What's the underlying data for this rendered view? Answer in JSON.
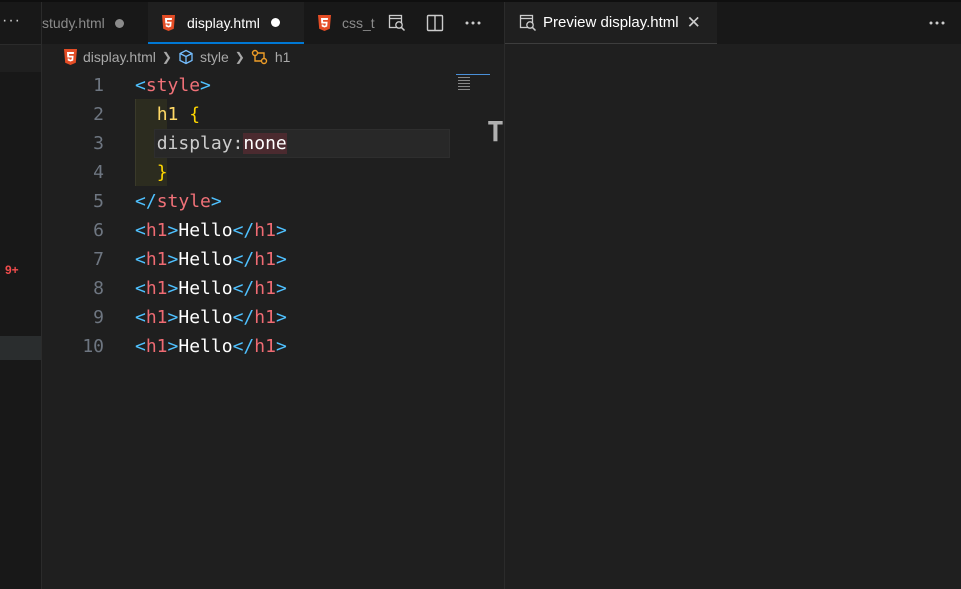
{
  "sidebar": {
    "more_label": "···",
    "problems_badge": "9+"
  },
  "tabs": [
    {
      "label": "study.html",
      "modified": true
    },
    {
      "label": "display.html",
      "modified": true,
      "active": true
    },
    {
      "label": "css_t",
      "modified": false
    }
  ],
  "breadcrumb": {
    "file": "display.html",
    "element": "style",
    "symbol": "h1"
  },
  "code": {
    "line_numbers": [
      "1",
      "2",
      "3",
      "4",
      "5",
      "6",
      "7",
      "8",
      "9",
      "10"
    ],
    "lines": [
      [
        {
          "t": "<",
          "c": "c-br"
        },
        {
          "t": "style",
          "c": "c-tag"
        },
        {
          "t": ">",
          "c": "c-br"
        }
      ],
      [
        {
          "t": "  "
        },
        {
          "t": "h1",
          "c": "c-sel"
        },
        {
          "t": " "
        },
        {
          "t": "{",
          "c": "c-brace"
        }
      ],
      [
        {
          "t": "  "
        },
        {
          "t": "display:",
          "c": "c-prop"
        },
        {
          "t": "none",
          "c": "c-text sel"
        }
      ],
      [
        {
          "t": "  "
        },
        {
          "t": "}",
          "c": "c-brace"
        }
      ],
      [
        {
          "t": "</",
          "c": "c-br"
        },
        {
          "t": "style",
          "c": "c-tag"
        },
        {
          "t": ">",
          "c": "c-br"
        }
      ],
      [
        {
          "t": "<",
          "c": "c-br"
        },
        {
          "t": "h1",
          "c": "c-tagpink"
        },
        {
          "t": ">",
          "c": "c-br"
        },
        {
          "t": "Hello",
          "c": "c-text"
        },
        {
          "t": "</",
          "c": "c-br"
        },
        {
          "t": "h1",
          "c": "c-tagpink"
        },
        {
          "t": ">",
          "c": "c-br"
        }
      ],
      [
        {
          "t": "<",
          "c": "c-br"
        },
        {
          "t": "h1",
          "c": "c-tagpink"
        },
        {
          "t": ">",
          "c": "c-br"
        },
        {
          "t": "Hello",
          "c": "c-text"
        },
        {
          "t": "</",
          "c": "c-br"
        },
        {
          "t": "h1",
          "c": "c-tagpink"
        },
        {
          "t": ">",
          "c": "c-br"
        }
      ],
      [
        {
          "t": "<",
          "c": "c-br"
        },
        {
          "t": "h1",
          "c": "c-tagpink"
        },
        {
          "t": ">",
          "c": "c-br"
        },
        {
          "t": "Hello",
          "c": "c-text"
        },
        {
          "t": "</",
          "c": "c-br"
        },
        {
          "t": "h1",
          "c": "c-tagpink"
        },
        {
          "t": ">",
          "c": "c-br"
        }
      ],
      [
        {
          "t": "<",
          "c": "c-br"
        },
        {
          "t": "h1",
          "c": "c-tagpink"
        },
        {
          "t": ">",
          "c": "c-br"
        },
        {
          "t": "Hello",
          "c": "c-text"
        },
        {
          "t": "</",
          "c": "c-br"
        },
        {
          "t": "h1",
          "c": "c-tagpink"
        },
        {
          "t": ">",
          "c": "c-br"
        }
      ],
      [
        {
          "t": "<",
          "c": "c-br"
        },
        {
          "t": "h1",
          "c": "c-tagpink"
        },
        {
          "t": ">",
          "c": "c-br"
        },
        {
          "t": "Hello",
          "c": "c-text"
        },
        {
          "t": "</",
          "c": "c-br"
        },
        {
          "t": "h1",
          "c": "c-tagpink"
        },
        {
          "t": ">",
          "c": "c-br"
        }
      ]
    ]
  },
  "preview": {
    "tab_label": "Preview display.html",
    "close_glyph": "✕"
  },
  "icons": {
    "html_file": "html5-file-icon",
    "preview": "preview-search-icon",
    "split": "split-editor-icon",
    "more": "more-actions-icon"
  },
  "colors": {
    "accent": "#0078d4",
    "html_icon": "#e44d26",
    "error": "#f14c4c"
  }
}
